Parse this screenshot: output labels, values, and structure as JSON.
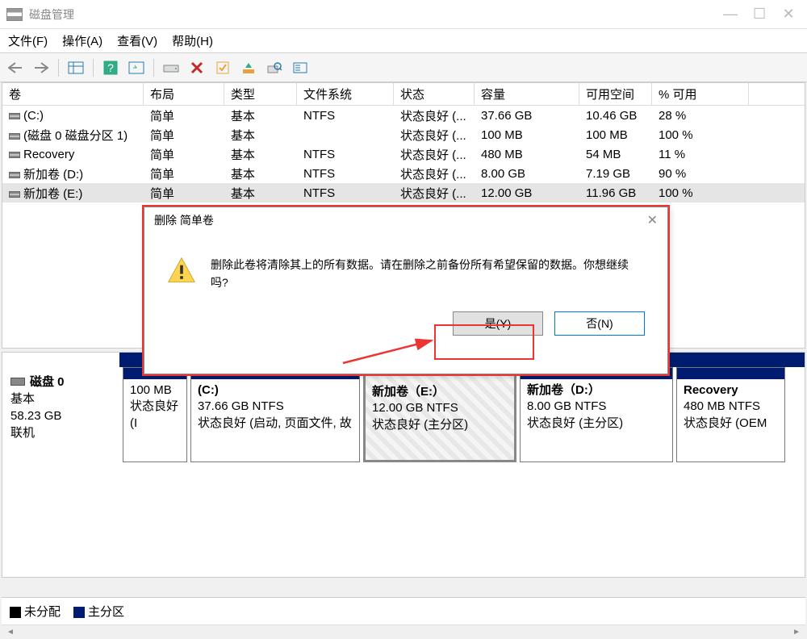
{
  "window": {
    "title": "磁盘管理"
  },
  "menu": {
    "file": "文件(F)",
    "action": "操作(A)",
    "view": "查看(V)",
    "help": "帮助(H)"
  },
  "table": {
    "headers": [
      "卷",
      "布局",
      "类型",
      "文件系统",
      "状态",
      "容量",
      "可用空间",
      "% 可用"
    ],
    "rows": [
      {
        "vol": "(C:)",
        "layout": "简单",
        "type": "基本",
        "fs": "NTFS",
        "status": "状态良好 (...",
        "cap": "37.66 GB",
        "free": "10.46 GB",
        "pct": "28 %"
      },
      {
        "vol": "(磁盘 0 磁盘分区 1)",
        "layout": "简单",
        "type": "基本",
        "fs": "",
        "status": "状态良好 (...",
        "cap": "100 MB",
        "free": "100 MB",
        "pct": "100 %"
      },
      {
        "vol": "Recovery",
        "layout": "简单",
        "type": "基本",
        "fs": "NTFS",
        "status": "状态良好 (...",
        "cap": "480 MB",
        "free": "54 MB",
        "pct": "11 %"
      },
      {
        "vol": "新加卷 (D:)",
        "layout": "简单",
        "type": "基本",
        "fs": "NTFS",
        "status": "状态良好 (...",
        "cap": "8.00 GB",
        "free": "7.19 GB",
        "pct": "90 %"
      },
      {
        "vol": "新加卷 (E:)",
        "layout": "简单",
        "type": "基本",
        "fs": "NTFS",
        "status": "状态良好 (...",
        "cap": "12.00 GB",
        "free": "11.96 GB",
        "pct": "100 %",
        "selected": true
      }
    ]
  },
  "disk": {
    "name": "磁盘 0",
    "type": "基本",
    "size": "58.23 GB",
    "status": "联机",
    "partitions": [
      {
        "name": "",
        "size": "100 MB",
        "fs": "",
        "status": "状态良好 (I"
      },
      {
        "name": "(C:)",
        "size": "37.66 GB NTFS",
        "fs": "",
        "status": "状态良好 (启动, 页面文件, 故"
      },
      {
        "name": "新加卷（E:）",
        "size": "12.00 GB NTFS",
        "fs": "",
        "status": "状态良好 (主分区)",
        "selected": true
      },
      {
        "name": "新加卷（D:）",
        "size": "8.00 GB NTFS",
        "fs": "",
        "status": "状态良好 (主分区)"
      },
      {
        "name": "Recovery",
        "size": "480 MB NTFS",
        "fs": "",
        "status": "状态良好 (OEM"
      }
    ]
  },
  "legend": {
    "unalloc": "未分配",
    "primary": "主分区"
  },
  "dialog": {
    "title": "删除 简单卷",
    "message": "删除此卷将清除其上的所有数据。请在删除之前备份所有希望保留的数据。你想继续吗?",
    "yes": "是(Y)",
    "no": "否(N)"
  }
}
